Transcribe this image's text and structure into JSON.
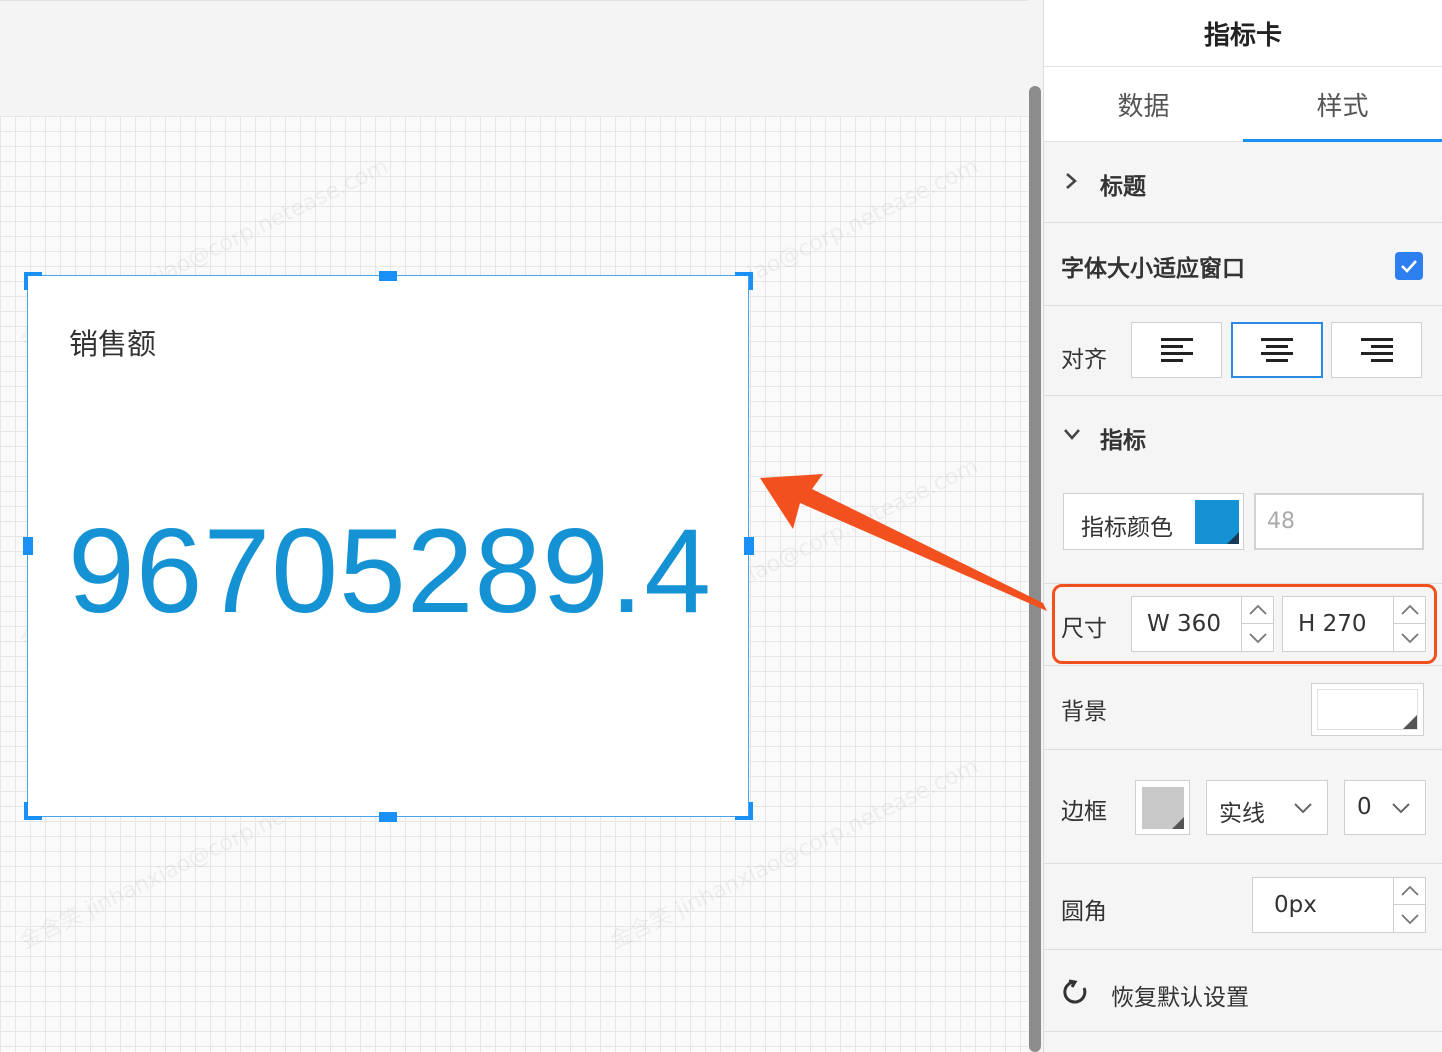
{
  "card": {
    "title": "销售额",
    "value": "96705289.4",
    "value_color": "#1592d4"
  },
  "watermark_text": "金含笑 jinhanxiao@corp.netease.com",
  "panel": {
    "title": "指标卡",
    "tabs": [
      {
        "label": "数据",
        "active": false
      },
      {
        "label": "样式",
        "active": true
      }
    ],
    "title_section": {
      "label": "标题",
      "expanded": false
    },
    "font_fit": {
      "label": "字体大小适应窗口",
      "checked": true
    },
    "align": {
      "label": "对齐",
      "options": [
        "left",
        "center",
        "right"
      ],
      "selected": "center"
    },
    "metric_section": {
      "label": "指标",
      "expanded": true
    },
    "metric_color": {
      "label": "指标颜色",
      "color": "#1592d4",
      "font_size": "48"
    },
    "size": {
      "label": "尺寸",
      "width": "W 360",
      "height": "H 270"
    },
    "background": {
      "label": "背景",
      "color": "#ffffff"
    },
    "border": {
      "label": "边框",
      "color": "#c8c8c8",
      "style": "实线",
      "width": "0"
    },
    "radius": {
      "label": "圆角",
      "value": "0px"
    },
    "reset": {
      "label": "恢复默认设置"
    }
  },
  "colors": {
    "accent": "#1890f5",
    "highlight": "#f3501f",
    "checkbox": "#2d7ff0"
  }
}
